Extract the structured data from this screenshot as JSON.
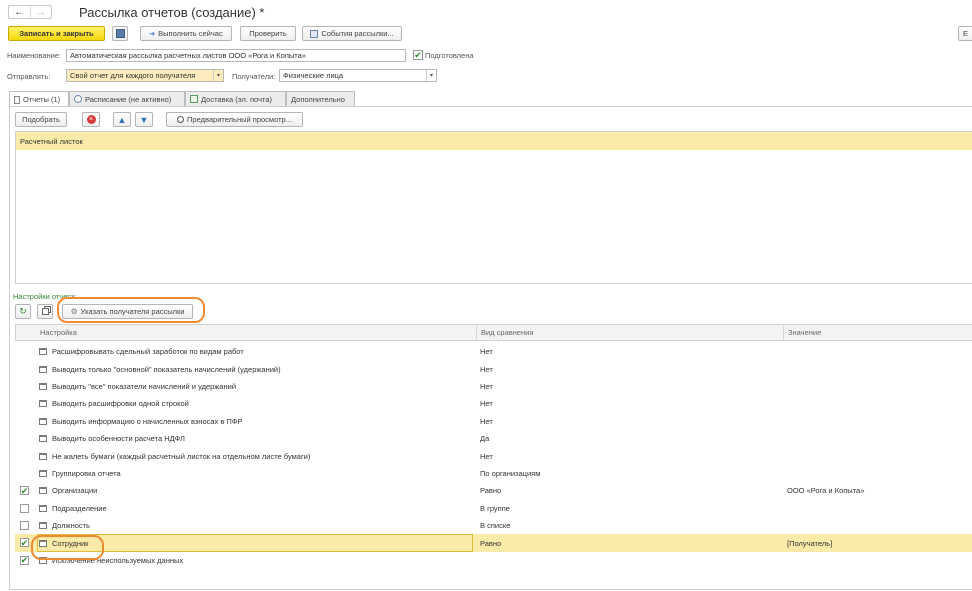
{
  "window": {
    "title": "Рассылка отчетов (создание) *"
  },
  "toolbar": {
    "save_close": "Записать и закрыть",
    "execute_now": "Выполнить сейчас",
    "check": "Проверить",
    "events": "События рассылки..."
  },
  "form": {
    "name_label": "Наименование:",
    "name_value": "Автоматическая рассылка расчетных листов ООО «Рога и Копыта»",
    "prepared_label": "Подготовлена",
    "send_label": "Отправлять:",
    "send_value": "Свой отчет для каждого получателя",
    "recipients_label": "Получатели:",
    "recipients_value": "Физические лица"
  },
  "tabs": [
    {
      "label": "Отчеты (1)"
    },
    {
      "label": "Расписание (не активно)"
    },
    {
      "label": "Доставка (эл. почта)"
    },
    {
      "label": "Дополнительно"
    }
  ],
  "reports_toolbar": {
    "pick": "Подобрать",
    "preview": "Предварительный просмотр..."
  },
  "reports": [
    {
      "name": "Расчетный листок"
    }
  ],
  "settings": {
    "title": "Настройки отчета:",
    "specify_recipient": "Указать получателя рассылки",
    "columns": {
      "setting": "Настройка",
      "comparison": "Вид сравнения",
      "value": "Значение"
    },
    "rows": [
      {
        "checkbox": false,
        "name": "Расшифровывать сдельный заработок по видам работ",
        "comparison": "Нет",
        "value": ""
      },
      {
        "checkbox": false,
        "name": "Выводить только \"основной\" показатель начислений (удержаний)",
        "comparison": "Нет",
        "value": ""
      },
      {
        "checkbox": false,
        "name": "Выводить \"все\" показатели начислений и удержаний",
        "comparison": "Нет",
        "value": ""
      },
      {
        "checkbox": false,
        "name": "Выводить расшифровки одной строкой",
        "comparison": "Нет",
        "value": ""
      },
      {
        "checkbox": false,
        "name": "Выводить информацию о начисленных взносах в ПФР",
        "comparison": "Нет",
        "value": ""
      },
      {
        "checkbox": false,
        "name": "Выводить особенности расчета НДФЛ",
        "comparison": "Да",
        "value": ""
      },
      {
        "checkbox": false,
        "name": "Не жалеть бумаги (каждый расчетный листок на отдельном листе бумаги)",
        "comparison": "Нет",
        "value": ""
      },
      {
        "checkbox": false,
        "name": "Группировка отчета",
        "comparison": "По организациям",
        "value": ""
      },
      {
        "checkbox": true,
        "checked": true,
        "name": "Организации",
        "comparison": "Равно",
        "value": "ООО «Рога и Копыта»"
      },
      {
        "checkbox": true,
        "checked": false,
        "name": "Подразделение",
        "comparison": "В группе",
        "value": ""
      },
      {
        "checkbox": true,
        "checked": false,
        "name": "Должность",
        "comparison": "В списке",
        "value": ""
      },
      {
        "checkbox": true,
        "checked": true,
        "name": "Сотрудник",
        "comparison": "Равно",
        "value": "[Получатель]"
      },
      {
        "checkbox": true,
        "checked": true,
        "name": "Исключение неиспользуемых данных",
        "comparison": "",
        "value": ""
      }
    ]
  }
}
